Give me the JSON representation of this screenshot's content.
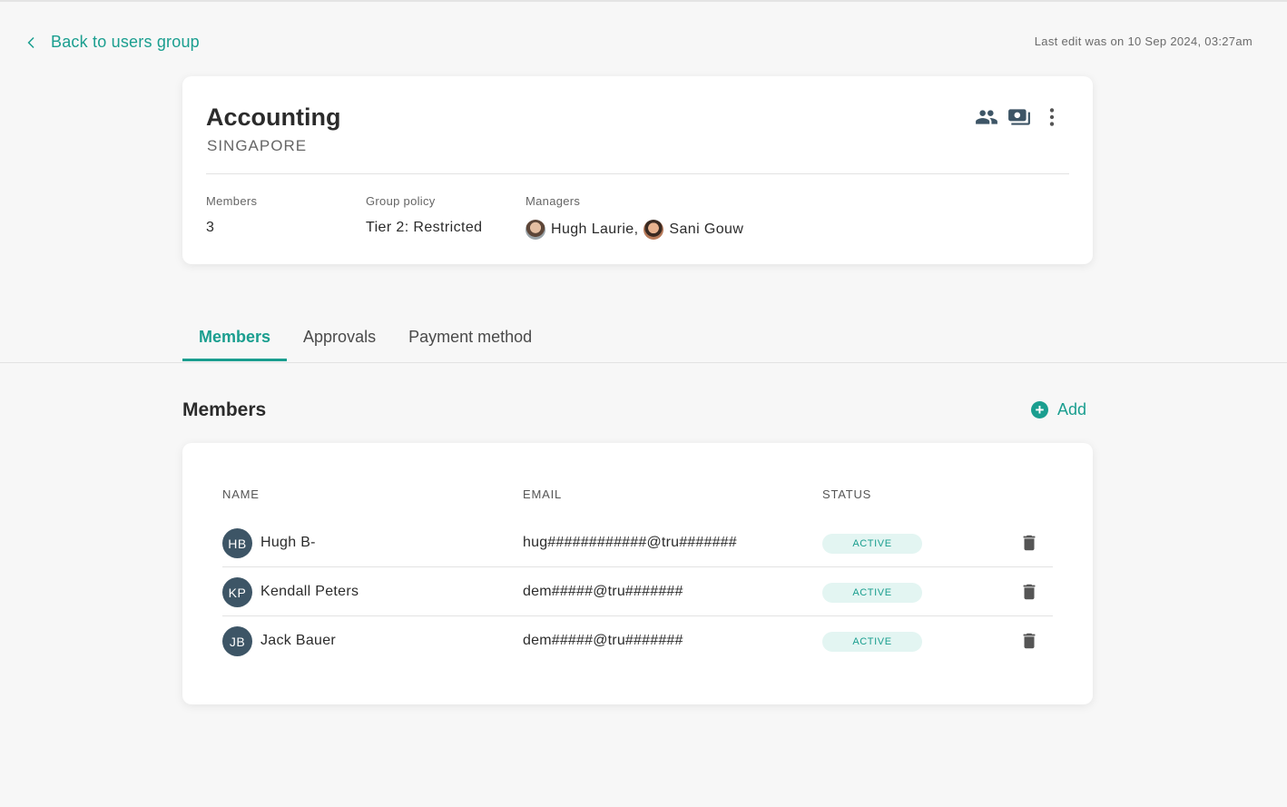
{
  "header": {
    "back_label": "Back to users group",
    "last_edit": "Last edit was on 10 Sep 2024, 03:27am"
  },
  "group": {
    "name": "Accounting",
    "location": "SINGAPORE",
    "members_label": "Members",
    "members_count": "3",
    "policy_label": "Group policy",
    "policy_value": "Tier 2: Restricted",
    "managers_label": "Managers",
    "managers": [
      "Hugh Laurie,",
      "Sani Gouw"
    ],
    "action_icons": [
      "group-icon",
      "payment-card-icon",
      "more-vert-icon"
    ]
  },
  "tabs": [
    {
      "label": "Members",
      "active": true
    },
    {
      "label": "Approvals",
      "active": false
    },
    {
      "label": "Payment method",
      "active": false
    }
  ],
  "members_section": {
    "title": "Members",
    "add_label": "Add",
    "columns": [
      "NAME",
      "EMAIL",
      "STATUS"
    ],
    "rows": [
      {
        "initials": "HB",
        "name": "Hugh B-",
        "email": "hug############@tru#######",
        "status": "ACTIVE"
      },
      {
        "initials": "KP",
        "name": "Kendall Peters",
        "email": "dem#####@tru#######",
        "status": "ACTIVE"
      },
      {
        "initials": "JB",
        "name": "Jack Bauer",
        "email": "dem#####@tru#######",
        "status": "ACTIVE"
      }
    ]
  },
  "colors": {
    "accent": "#1a9e8f",
    "avatar_bg": "#3d5566",
    "status_bg": "#e3f5f2",
    "page_bg": "#f7f7f7"
  }
}
